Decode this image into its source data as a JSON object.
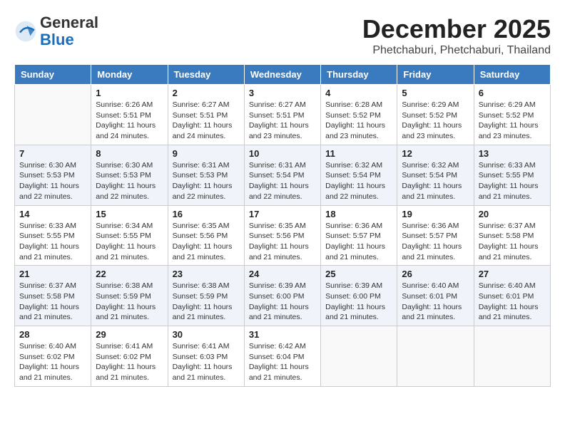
{
  "logo": {
    "general": "General",
    "blue": "Blue"
  },
  "header": {
    "month": "December 2025",
    "location": "Phetchaburi, Phetchaburi, Thailand"
  },
  "weekdays": [
    "Sunday",
    "Monday",
    "Tuesday",
    "Wednesday",
    "Thursday",
    "Friday",
    "Saturday"
  ],
  "weeks": [
    [
      {
        "day": "",
        "info": ""
      },
      {
        "day": "1",
        "info": "Sunrise: 6:26 AM\nSunset: 5:51 PM\nDaylight: 11 hours\nand 24 minutes."
      },
      {
        "day": "2",
        "info": "Sunrise: 6:27 AM\nSunset: 5:51 PM\nDaylight: 11 hours\nand 24 minutes."
      },
      {
        "day": "3",
        "info": "Sunrise: 6:27 AM\nSunset: 5:51 PM\nDaylight: 11 hours\nand 23 minutes."
      },
      {
        "day": "4",
        "info": "Sunrise: 6:28 AM\nSunset: 5:52 PM\nDaylight: 11 hours\nand 23 minutes."
      },
      {
        "day": "5",
        "info": "Sunrise: 6:29 AM\nSunset: 5:52 PM\nDaylight: 11 hours\nand 23 minutes."
      },
      {
        "day": "6",
        "info": "Sunrise: 6:29 AM\nSunset: 5:52 PM\nDaylight: 11 hours\nand 23 minutes."
      }
    ],
    [
      {
        "day": "7",
        "info": "Sunrise: 6:30 AM\nSunset: 5:53 PM\nDaylight: 11 hours\nand 22 minutes."
      },
      {
        "day": "8",
        "info": "Sunrise: 6:30 AM\nSunset: 5:53 PM\nDaylight: 11 hours\nand 22 minutes."
      },
      {
        "day": "9",
        "info": "Sunrise: 6:31 AM\nSunset: 5:53 PM\nDaylight: 11 hours\nand 22 minutes."
      },
      {
        "day": "10",
        "info": "Sunrise: 6:31 AM\nSunset: 5:54 PM\nDaylight: 11 hours\nand 22 minutes."
      },
      {
        "day": "11",
        "info": "Sunrise: 6:32 AM\nSunset: 5:54 PM\nDaylight: 11 hours\nand 22 minutes."
      },
      {
        "day": "12",
        "info": "Sunrise: 6:32 AM\nSunset: 5:54 PM\nDaylight: 11 hours\nand 21 minutes."
      },
      {
        "day": "13",
        "info": "Sunrise: 6:33 AM\nSunset: 5:55 PM\nDaylight: 11 hours\nand 21 minutes."
      }
    ],
    [
      {
        "day": "14",
        "info": "Sunrise: 6:33 AM\nSunset: 5:55 PM\nDaylight: 11 hours\nand 21 minutes."
      },
      {
        "day": "15",
        "info": "Sunrise: 6:34 AM\nSunset: 5:55 PM\nDaylight: 11 hours\nand 21 minutes."
      },
      {
        "day": "16",
        "info": "Sunrise: 6:35 AM\nSunset: 5:56 PM\nDaylight: 11 hours\nand 21 minutes."
      },
      {
        "day": "17",
        "info": "Sunrise: 6:35 AM\nSunset: 5:56 PM\nDaylight: 11 hours\nand 21 minutes."
      },
      {
        "day": "18",
        "info": "Sunrise: 6:36 AM\nSunset: 5:57 PM\nDaylight: 11 hours\nand 21 minutes."
      },
      {
        "day": "19",
        "info": "Sunrise: 6:36 AM\nSunset: 5:57 PM\nDaylight: 11 hours\nand 21 minutes."
      },
      {
        "day": "20",
        "info": "Sunrise: 6:37 AM\nSunset: 5:58 PM\nDaylight: 11 hours\nand 21 minutes."
      }
    ],
    [
      {
        "day": "21",
        "info": "Sunrise: 6:37 AM\nSunset: 5:58 PM\nDaylight: 11 hours\nand 21 minutes."
      },
      {
        "day": "22",
        "info": "Sunrise: 6:38 AM\nSunset: 5:59 PM\nDaylight: 11 hours\nand 21 minutes."
      },
      {
        "day": "23",
        "info": "Sunrise: 6:38 AM\nSunset: 5:59 PM\nDaylight: 11 hours\nand 21 minutes."
      },
      {
        "day": "24",
        "info": "Sunrise: 6:39 AM\nSunset: 6:00 PM\nDaylight: 11 hours\nand 21 minutes."
      },
      {
        "day": "25",
        "info": "Sunrise: 6:39 AM\nSunset: 6:00 PM\nDaylight: 11 hours\nand 21 minutes."
      },
      {
        "day": "26",
        "info": "Sunrise: 6:40 AM\nSunset: 6:01 PM\nDaylight: 11 hours\nand 21 minutes."
      },
      {
        "day": "27",
        "info": "Sunrise: 6:40 AM\nSunset: 6:01 PM\nDaylight: 11 hours\nand 21 minutes."
      }
    ],
    [
      {
        "day": "28",
        "info": "Sunrise: 6:40 AM\nSunset: 6:02 PM\nDaylight: 11 hours\nand 21 minutes."
      },
      {
        "day": "29",
        "info": "Sunrise: 6:41 AM\nSunset: 6:02 PM\nDaylight: 11 hours\nand 21 minutes."
      },
      {
        "day": "30",
        "info": "Sunrise: 6:41 AM\nSunset: 6:03 PM\nDaylight: 11 hours\nand 21 minutes."
      },
      {
        "day": "31",
        "info": "Sunrise: 6:42 AM\nSunset: 6:04 PM\nDaylight: 11 hours\nand 21 minutes."
      },
      {
        "day": "",
        "info": ""
      },
      {
        "day": "",
        "info": ""
      },
      {
        "day": "",
        "info": ""
      }
    ]
  ]
}
